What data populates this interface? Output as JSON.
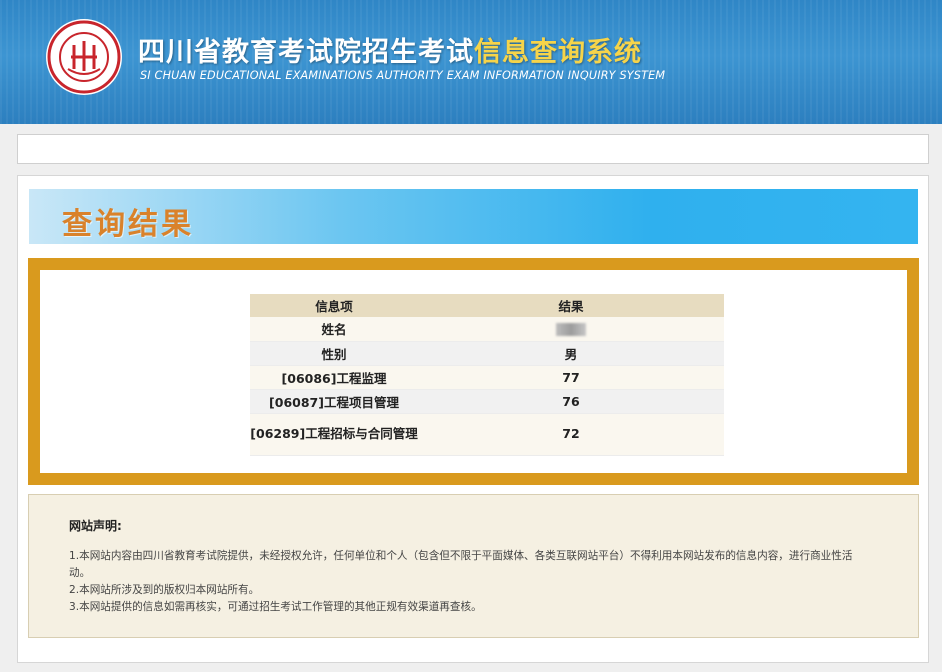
{
  "header": {
    "title_main": "四川省教育考试院招生考试",
    "title_highlight": "信息查询系统",
    "subtitle": "SI CHUAN EDUCATIONAL EXAMINATIONS AUTHORITY EXAM INFORMATION INQUIRY SYSTEM",
    "logo": {
      "icon": "seal-logo-icon",
      "color": "#c8252c"
    }
  },
  "banner": {
    "title": "查询结果"
  },
  "result_table": {
    "headers": [
      "信息项",
      "结果"
    ],
    "rows": [
      {
        "label": "姓名",
        "value": ""
      },
      {
        "label": "性别",
        "value": "男"
      },
      {
        "label": "[06086]工程监理",
        "value": "77"
      },
      {
        "label": "[06087]工程项目管理",
        "value": "76"
      },
      {
        "label": "[06289]工程招标与合同管理",
        "value": "72"
      }
    ]
  },
  "notice": {
    "title": "网站声明:",
    "items": [
      "1.本网站内容由四川省教育考试院提供，未经授权允许，任何单位和个人（包含但不限于平面媒体、各类互联网站平台）不得利用本网站发布的信息内容，进行商业性活动。",
      "2.本网站所涉及到的版权归本网站所有。",
      "3.本网站提供的信息如需再核实，可通过招生考试工作管理的其他正规有效渠道再查核。"
    ]
  },
  "colors": {
    "header_blue": "#2f86c6",
    "title_highlight": "#f6d44a",
    "banner_text": "#d9822b",
    "frame_gold": "#d99a1e"
  }
}
